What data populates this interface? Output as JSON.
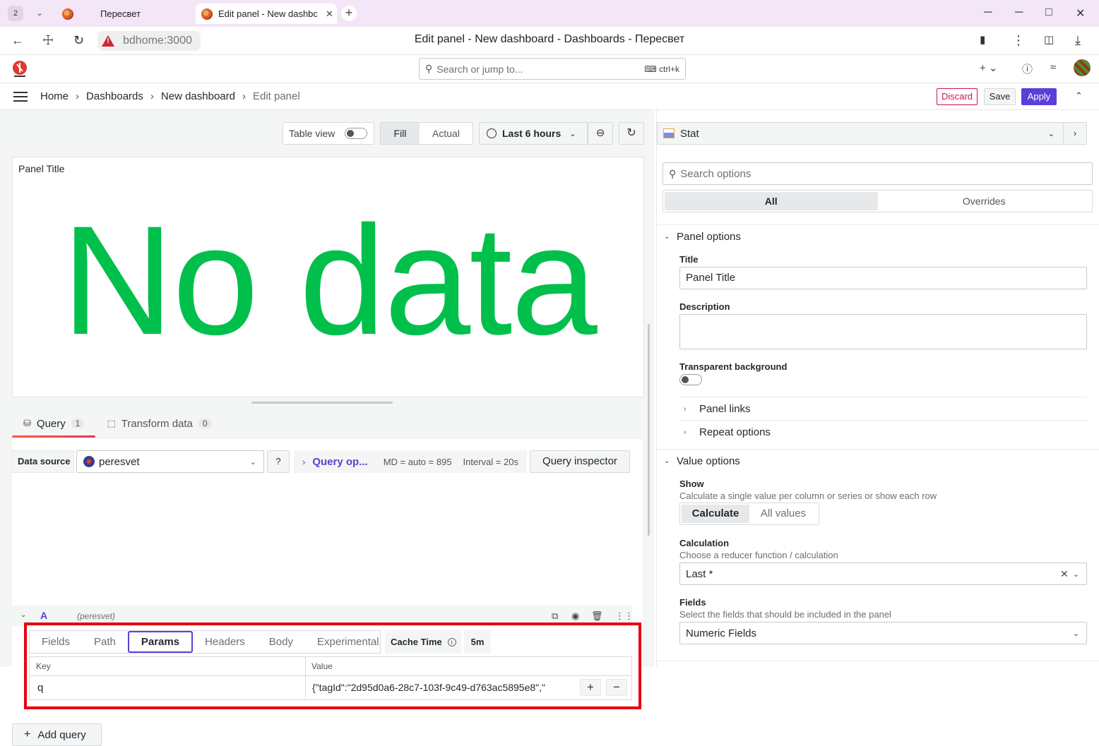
{
  "browser": {
    "tab_count": "2",
    "tabs": [
      {
        "title": "Пересвет"
      },
      {
        "title": "Edit panel - New dashboard"
      }
    ],
    "url": "bdhome:3000",
    "page_title": "Edit panel - New dashboard - Dashboards - Пересвет"
  },
  "topnav": {
    "search_placeholder": "Search or jump to...",
    "search_shortcut": "ctrl+k"
  },
  "breadcrumb": [
    "Home",
    "Dashboards",
    "New dashboard",
    "Edit panel"
  ],
  "actions": {
    "discard": "Discard",
    "save": "Save",
    "apply": "Apply"
  },
  "toolbar": {
    "table_view": "Table view",
    "fill": "Fill",
    "actual": "Actual",
    "time_range": "Last 6 hours"
  },
  "panel": {
    "title": "Panel Title",
    "message": "No data",
    "message_color": "#00c04b"
  },
  "query_tabs": [
    {
      "label": "Query",
      "count": "1"
    },
    {
      "label": "Transform data",
      "count": "0"
    }
  ],
  "datasource": {
    "label": "Data source",
    "value": "peresvet",
    "query_options": "Query op...",
    "md": "MD = auto = 895",
    "interval": "Interval = 20s",
    "inspector": "Query inspector"
  },
  "query": {
    "ref": "A",
    "datasource": "(peresvet)",
    "subtabs": [
      "Fields",
      "Path",
      "Params",
      "Headers",
      "Body",
      "Experimental"
    ],
    "active_subtab": "Params",
    "cache_time_label": "Cache Time",
    "cache_time_value": "5m",
    "params": {
      "key_header": "Key",
      "value_header": "Value",
      "rows": [
        {
          "key": "q",
          "value": "{\"tagId\":\"2d95d0a6-28c7-103f-9c49-d763ac5895e8\",\""
        }
      ]
    },
    "add_query": "Add query"
  },
  "options": {
    "viz": "Stat",
    "search_placeholder": "Search options",
    "tabs": [
      "All",
      "Overrides"
    ],
    "panel_options": {
      "heading": "Panel options",
      "title_label": "Title",
      "title_value": "Panel Title",
      "description_label": "Description",
      "transparent_label": "Transparent background",
      "panel_links": "Panel links",
      "repeat_options": "Repeat options"
    },
    "value_options": {
      "heading": "Value options",
      "show_label": "Show",
      "show_desc": "Calculate a single value per column or series or show each row",
      "show_options": [
        "Calculate",
        "All values"
      ],
      "calculation_label": "Calculation",
      "calculation_desc": "Choose a reducer function / calculation",
      "calculation_value": "Last *",
      "fields_label": "Fields",
      "fields_desc": "Select the fields that should be included in the panel",
      "fields_value": "Numeric Fields"
    }
  }
}
